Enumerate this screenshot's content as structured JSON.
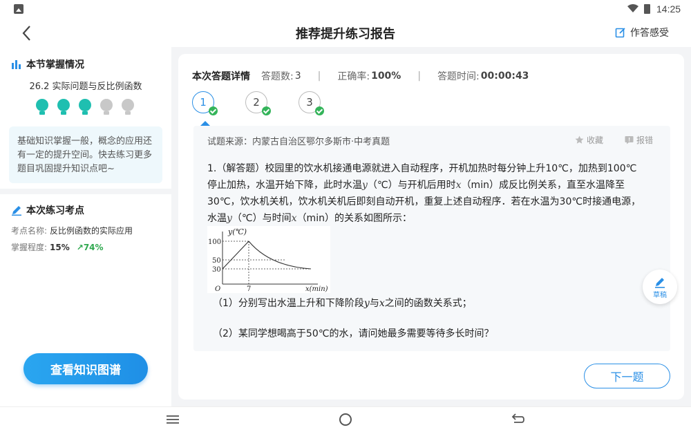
{
  "status_bar": {
    "time": "14:25"
  },
  "header": {
    "title": "推荐提升练习报告",
    "feedback_label": "作答感受"
  },
  "sidebar": {
    "mastery_heading": "本节掌握情况",
    "chapter": "26.2 实际问题与反比例函数",
    "bulbs_lit": 3,
    "bulbs_total": 5,
    "tip": "基础知识掌握一般，概念的应用还有一定的提升空间。快去练习更多题目巩固提升知识点吧~",
    "kp_heading": "本次练习考点",
    "kp_name_label": "考点名称:",
    "kp_name": "反比例函数的实际应用",
    "kp_level_label": "掌握程度:",
    "kp_level": "15%",
    "kp_up": "↗74%",
    "map_button": "查看知识图谱"
  },
  "stats": {
    "title": "本次答题详情",
    "count_label": "答题数:",
    "count": "3",
    "accuracy_label": "正确率:",
    "accuracy": "100%",
    "time_label": "答题时间:",
    "time": "00:00:43",
    "sep": "|"
  },
  "question_nav": [
    "1",
    "2",
    "3"
  ],
  "question": {
    "source": "试题来源：内蒙古自治区鄂尔多斯市·中考真题",
    "collect": "收藏",
    "report": "报错",
    "stem_l1": "1.（解答题）校园里的饮水机接通电源就进入自动程序，开机加热时每分钟上升10℃，加热到100℃",
    "stem_l2a": "停止加热，水温开始下降，此时水温",
    "var_y": "y",
    "stem_l2b": "（℃）与开机后用时",
    "var_x": "x",
    "stem_l2c": "（min）成反比例关系，直至水温降至",
    "stem_l3": "30℃，饮水机关机，饮水机关机后即刻自动开机，重复上述自动程序．若在水温为30℃时接通电源，",
    "stem_l4a": "水温",
    "stem_l4b": "（℃）与时间",
    "stem_l4c": "（min）的关系如图所示：",
    "sub1_a": "（1）分别写出水温上升和下降阶段",
    "sub1_b": "与",
    "sub1_c": "之间的函数关系式；",
    "sub2": "（2）某同学想喝高于50℃的水，请问她最多需要等待多长时间？",
    "draft": "草稿",
    "next": "下一题"
  },
  "figure": {
    "y_label": "y(℃)",
    "x_label": "x(min)",
    "origin": "O",
    "y_ticks": [
      "100",
      "50",
      "30"
    ],
    "x_tick": "7"
  }
}
